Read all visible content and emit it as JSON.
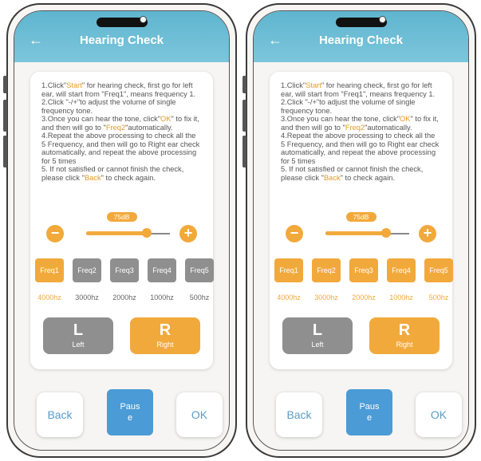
{
  "screen": {
    "title": "Hearing Check",
    "back_arrow": "←",
    "instructions": [
      [
        "1.Click\"",
        "Start",
        "\" for hearing check, first go for left ear, will start from \"Freq1\", means frequency 1."
      ],
      [
        "2.Click \"-/+\"to adjust the volume of single frequency tone."
      ],
      [
        "3.Once you can hear the tone, click\"",
        "OK",
        "\" to fix it, and then will go to \"",
        "Freq2",
        "\"automatically."
      ],
      [
        "4.Repeat the above processing to check all the 5 Frequency, and then will go to Right ear check automatically, and repeat the above processing for 5 times"
      ],
      [
        "5. If not satisfied or cannot finish the check, please click \"",
        "Back",
        "\" to check again."
      ]
    ],
    "volume_label": "75dB",
    "volume_level_fraction": 0.72,
    "minus": "−",
    "plus": "+",
    "freqs": [
      "Freq1",
      "Freq2",
      "Freq3",
      "Freq4",
      "Freq5"
    ],
    "hz": [
      "4000hz",
      "3000hz",
      "2000hz",
      "1000hz",
      "500hz"
    ],
    "left": {
      "big": "L",
      "small": "Left"
    },
    "right": {
      "big": "R",
      "small": "Right"
    },
    "buttons": {
      "back": "Back",
      "pause": "Pause",
      "ok": "OK"
    }
  },
  "phones": [
    {
      "active_freqs": [
        true,
        false,
        false,
        false,
        false
      ],
      "left_active": false
    },
    {
      "active_freqs": [
        true,
        true,
        true,
        true,
        true
      ],
      "left_active": false
    }
  ],
  "colors": {
    "accent": "#f2a93b",
    "inactive": "#8f8f8f",
    "header": "#6bbdd6",
    "pause": "#4a9bd6"
  }
}
